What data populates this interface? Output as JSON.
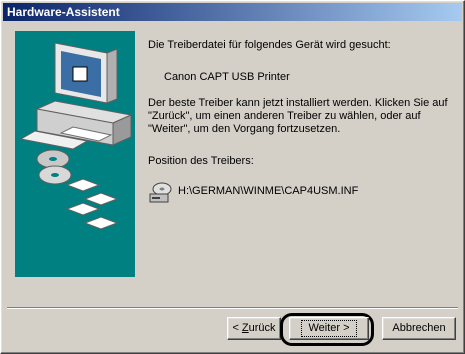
{
  "window": {
    "title": "Hardware-Assistent"
  },
  "content": {
    "line1": "Die Treiberdatei für folgendes Gerät wird gesucht:",
    "device_name": "Canon CAPT USB Printer",
    "instructions": "Der beste Treiber kann jetzt installiert werden. Klicken Sie auf \"Zurück\", um einen anderen Treiber zu wählen, oder auf \"Weiter\", um den Vorgang fortzusetzen.",
    "location_label": "Position des Treibers:",
    "driver_path": "H:\\GERMAN\\WINME\\CAP4USM.INF"
  },
  "buttons": {
    "back_prefix": "< ",
    "back_mnemonic": "Z",
    "back_rest": "urück",
    "next": "Weiter >",
    "cancel": "Abbrechen"
  },
  "colors": {
    "title_start": "#0a246a",
    "title_end": "#a6caf0",
    "illustration_bg": "#008080"
  },
  "icons": [
    "computer-icon",
    "cd-icon",
    "floppy-disk-icon",
    "cd-drive-icon"
  ]
}
